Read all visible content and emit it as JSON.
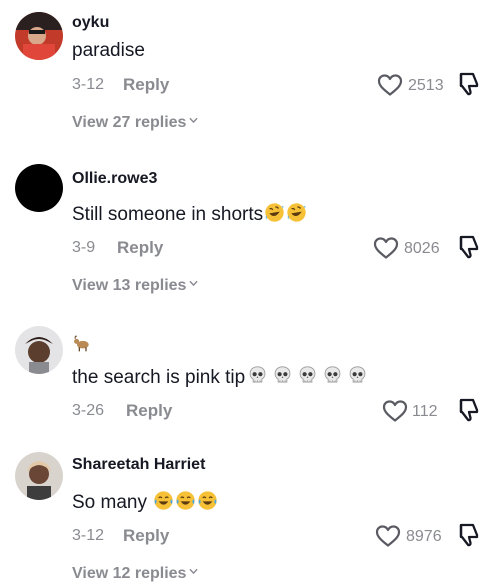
{
  "comments": [
    {
      "username": "oyku",
      "text": "paradise",
      "date": "3-12",
      "reply_label": "Reply",
      "likes": "2513",
      "view_replies": "View 27 replies"
    },
    {
      "username": "Ollie.rowe3",
      "text": "Still someone in shorts",
      "date": "3-9",
      "reply_label": "Reply",
      "likes": "8026",
      "view_replies": "View 13 replies"
    },
    {
      "username": "",
      "text": "the search is pink tip",
      "date": "3-26",
      "reply_label": "Reply",
      "likes": "112"
    },
    {
      "username": "Shareetah Harriet",
      "text": "So many",
      "date": "3-12",
      "reply_label": "Reply",
      "likes": "8976",
      "view_replies": "View 12 replies"
    }
  ],
  "icons": {
    "like": "heart-outline-icon",
    "dislike": "thumbs-down-outline-icon",
    "chevron": "chevron-down-icon",
    "laugh": "rolling-laughing-emoji",
    "skull": "skull-emoji",
    "tears": "tears-of-joy-emoji",
    "badge": "goat-emoji"
  },
  "colors": {
    "primary_text": "#161823",
    "secondary_text": "#8a8b91",
    "background": "#ffffff"
  }
}
